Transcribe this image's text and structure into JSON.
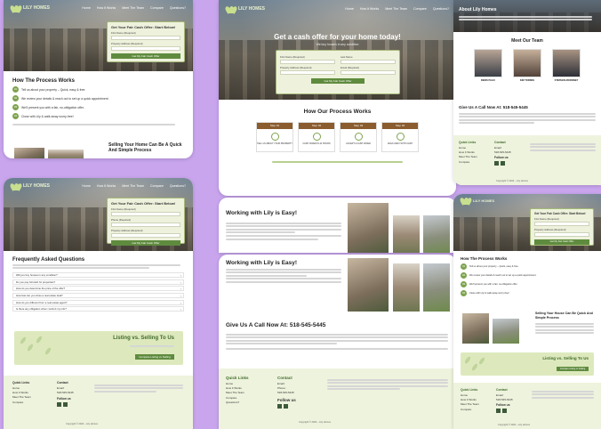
{
  "brand": {
    "name": "LILY HOMES",
    "accent": "#5f8b3e",
    "button_brown": "#8a5c2e",
    "background": "#c9a5ee"
  },
  "nav": {
    "items": [
      "Home",
      "How It Works",
      "Meet The Team",
      "Compare",
      "Questions?"
    ]
  },
  "form": {
    "title": "Get Your Fair Cash Offer: Start Below!",
    "first_name": "First Name (Required)",
    "last_name": "Last Name",
    "address": "Property Address (Required)",
    "phone": "Phone (Required)",
    "email": "Email (Required)",
    "button": "Get My Fair Cash Offer"
  },
  "left_top": {
    "process_title": "How The Process Works",
    "steps": [
      "Tell us about your property – Quick, easy & free.",
      "We review your details & reach out to set up a quick appointment.",
      "We'll present you with a fair, no-obligation offer.",
      "Close with Lily & walk away worry-free!"
    ],
    "teaser": "Selling Your Home Can Be A Quick And Simple Process"
  },
  "left_bottom": {
    "faq_title": "Frequently Asked Questions",
    "questions": [
      "Will you buy houses in any condition?",
      "Do you pay full cash for properties?",
      "How do you determine the price of the offer?",
      "How fast can you close a real estate deal?",
      "How do you different from a real estate agent?",
      "Is there any obligation when I submit my info?"
    ],
    "cta_title": "Listing vs. Selling To Us",
    "cta_button": "Compare Listing vs Selling"
  },
  "center": {
    "hero_title": "Get a cash offer for your home today!",
    "hero_sub": "We buy houses in any condition",
    "process_title": "How Our Process Works",
    "steps": [
      {
        "head": "Step 01",
        "label": "TELL US ABOUT YOUR PROPERTY"
      },
      {
        "head": "Step 02",
        "label": "CASH OFFER IN 24 HOURS"
      },
      {
        "head": "Step 03",
        "label": "ACCEPT A CASH OFFER"
      },
      {
        "head": "Step 04",
        "label": "WALK AWAY WITH CASH"
      }
    ],
    "easy_title": "Working with Lily is Easy!",
    "call_title": "Give Us A Call Now At: 518-545-5445"
  },
  "right_top": {
    "about_title": "About Lily Homes",
    "team_title": "Meet Our Team",
    "team": [
      "DENIS PALIC",
      "KIM TORRES",
      "STEPHEN MCKINNEY"
    ],
    "call_title": "Give Us A Call Now At: 518-545-5445"
  },
  "right_bottom": {
    "process_title": "How The Process Works",
    "teaser": "Selling Your House Can Be Quick And Simple Process",
    "cta_title": "Listing vs. Selling To Us"
  },
  "footer": {
    "quick_links": "Quick Links",
    "links": [
      "Home",
      "How It Works",
      "Meet The Team",
      "Compare",
      "Questions?"
    ],
    "contact": "Contact",
    "email_label": "Email:",
    "phone_label": "Phone:",
    "phone": "518-545-5445",
    "follow": "Follow us",
    "copyright": "Copyright © 2024 – Lily Homes"
  }
}
